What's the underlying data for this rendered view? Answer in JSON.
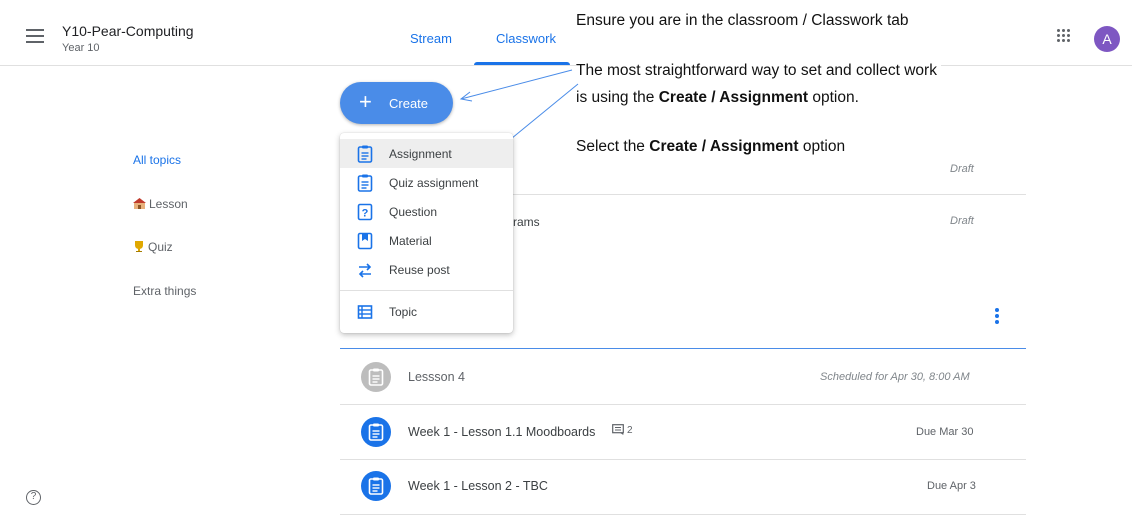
{
  "header": {
    "class_name": "Y10-Pear-Computing",
    "class_section": "Year 10",
    "tabs": [
      {
        "label": "Stream"
      },
      {
        "label": "Classwork"
      }
    ],
    "avatar_letter": "A"
  },
  "annotations": {
    "line1": "Ensure you are in the classroom / Classwork tab",
    "line2": "The most straightforward way to set and collect work",
    "line3_prefix": "is using the ",
    "line3_bold": "Create / Assignment",
    "line3_suffix": " option.",
    "line4_prefix": "Select the ",
    "line4_bold": "Create / Assignment",
    "line4_suffix": " option"
  },
  "create_button": {
    "icon": "plus-icon",
    "label": "Create"
  },
  "create_menu": {
    "items": [
      {
        "label": "Assignment",
        "icon": "assignment-icon"
      },
      {
        "label": "Quiz assignment",
        "icon": "quiz-assignment-icon"
      },
      {
        "label": "Question",
        "icon": "question-icon"
      },
      {
        "label": "Material",
        "icon": "material-icon"
      },
      {
        "label": "Reuse post",
        "icon": "reuse-icon"
      },
      {
        "label": "Topic",
        "icon": "topic-icon"
      }
    ]
  },
  "sidebar": {
    "topics": [
      {
        "label": "All topics"
      },
      {
        "label": "Lesson"
      },
      {
        "label": "Quiz"
      },
      {
        "label": "Extra things"
      }
    ]
  },
  "drafts": {
    "row1_status": "Draft",
    "row2_partial_title": "rams",
    "row2_status": "Draft"
  },
  "classwork_items": [
    {
      "title": "Lessson 4",
      "meta": "Scheduled for Apr 30, 8:00 AM"
    },
    {
      "title": "Week 1 - Lesson 1.1 Moodboards",
      "comments": "2",
      "meta": "Due Mar 30"
    },
    {
      "title": "Week 1 - Lesson 2 - TBC",
      "meta": "Due Apr 3"
    }
  ],
  "colors": {
    "accent": "#1a73e8",
    "create_button": "#4a8ce8",
    "avatar": "#7e57c2"
  }
}
